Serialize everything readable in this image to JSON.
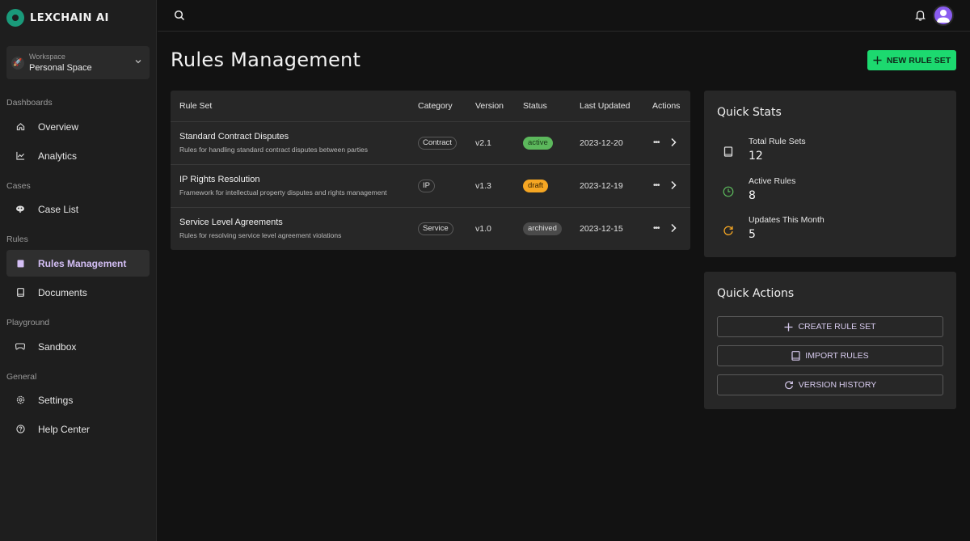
{
  "app": {
    "name": "LEXCHAIN AI"
  },
  "workspace": {
    "label": "Workspace",
    "name": "Personal Space"
  },
  "sidebar": {
    "sections": [
      {
        "title": "Dashboards",
        "items": [
          {
            "label": "Overview",
            "icon": "home-icon"
          },
          {
            "label": "Analytics",
            "icon": "chart-line-icon"
          }
        ]
      },
      {
        "title": "Cases",
        "items": [
          {
            "label": "Case List",
            "icon": "scale-icon"
          }
        ]
      },
      {
        "title": "Rules",
        "items": [
          {
            "label": "Rules Management",
            "icon": "book-icon",
            "active": true
          },
          {
            "label": "Documents",
            "icon": "document-icon"
          }
        ]
      },
      {
        "title": "Playground",
        "items": [
          {
            "label": "Sandbox",
            "icon": "gamepad-icon"
          }
        ]
      },
      {
        "title": "General",
        "items": [
          {
            "label": "Settings",
            "icon": "gear-icon"
          },
          {
            "label": "Help Center",
            "icon": "help-icon"
          }
        ]
      }
    ]
  },
  "page": {
    "title": "Rules Management",
    "new_button": "NEW RULE SET"
  },
  "table": {
    "headers": [
      "Rule Set",
      "Category",
      "Version",
      "Status",
      "Last Updated",
      "Actions"
    ],
    "rows": [
      {
        "name": "Standard Contract Disputes",
        "description": "Rules for handling standard contract disputes between parties",
        "category": "Contract",
        "version": "v2.1",
        "status": "active",
        "updated": "2023-12-20"
      },
      {
        "name": "IP Rights Resolution",
        "description": "Framework for intellectual property disputes and rights management",
        "category": "IP",
        "version": "v1.3",
        "status": "draft",
        "updated": "2023-12-19"
      },
      {
        "name": "Service Level Agreements",
        "description": "Rules for resolving service level agreement violations",
        "category": "Service",
        "version": "v1.0",
        "status": "archived",
        "updated": "2023-12-15"
      }
    ]
  },
  "status_colors": {
    "active": "#5cb85c",
    "draft": "#f5a623",
    "archived": "#4a4a4a"
  },
  "quick_stats": {
    "title": "Quick Stats",
    "items": [
      {
        "label": "Total Rule Sets",
        "value": "12",
        "icon": "book-icon"
      },
      {
        "label": "Active Rules",
        "value": "8",
        "icon": "clock-icon"
      },
      {
        "label": "Updates This Month",
        "value": "5",
        "icon": "refresh-icon"
      }
    ]
  },
  "quick_actions": {
    "title": "Quick Actions",
    "buttons": [
      {
        "label": "CREATE RULE SET",
        "icon": "plus-icon"
      },
      {
        "label": "IMPORT RULES",
        "icon": "book-icon"
      },
      {
        "label": "VERSION HISTORY",
        "icon": "refresh-icon"
      }
    ]
  }
}
